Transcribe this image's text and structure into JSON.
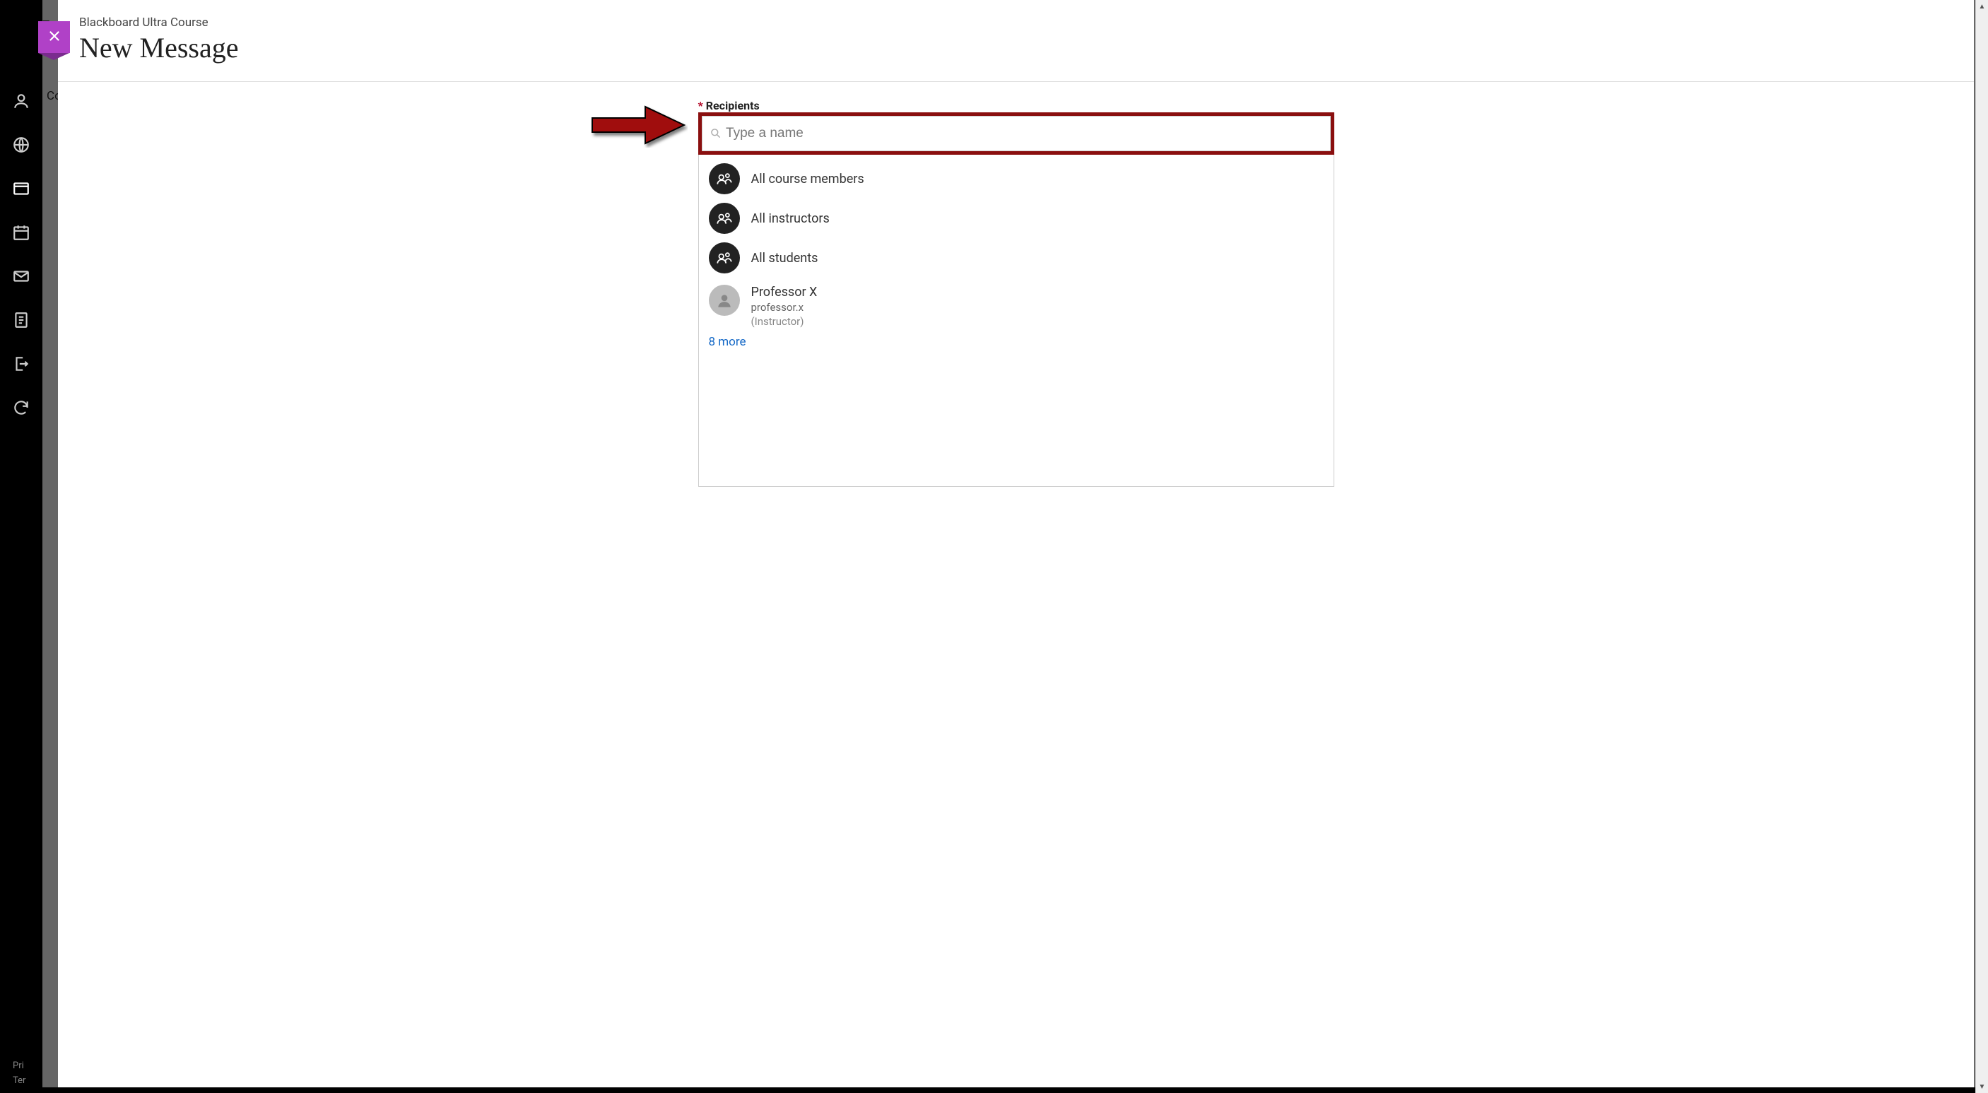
{
  "nav": {
    "items": [
      {
        "name": "profile-icon"
      },
      {
        "name": "globe-icon"
      },
      {
        "name": "courses-icon",
        "active": true
      },
      {
        "name": "calendar-icon"
      },
      {
        "name": "messages-icon"
      },
      {
        "name": "document-icon"
      },
      {
        "name": "signout-icon"
      },
      {
        "name": "sync-icon"
      }
    ],
    "footer": {
      "line1": "Pri",
      "line2": "Ter"
    }
  },
  "backdrop": {
    "tab_prefix": "Co",
    "top_prefix": "T"
  },
  "panel": {
    "breadcrumb": "Blackboard Ultra Course",
    "title": "New Message",
    "close_label": "Close"
  },
  "form": {
    "recipients_label": "Recipients",
    "required_marker": "*",
    "search_placeholder": "Type a name",
    "suggestions": [
      {
        "kind": "group",
        "label": "All course members"
      },
      {
        "kind": "group",
        "label": "All instructors"
      },
      {
        "kind": "group",
        "label": "All students"
      },
      {
        "kind": "person",
        "name": "Professor X",
        "username": "professor.x",
        "role": "(Instructor)"
      }
    ],
    "more_link": "8 more"
  }
}
